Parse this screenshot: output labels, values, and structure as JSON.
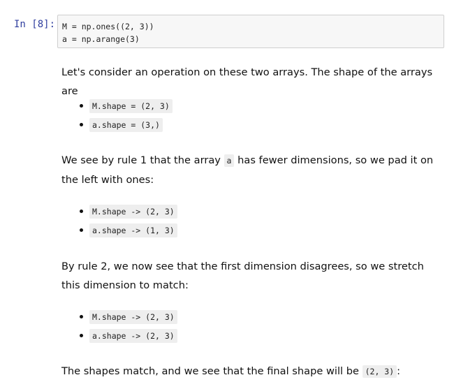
{
  "cell": {
    "prompt": "In [8]:",
    "code_lines": [
      "M = np.ones((2, 3))",
      "a = np.arange(3)"
    ]
  },
  "markdown": {
    "p1": "Let's consider an operation on these two arrays. The shape of the arrays are",
    "list1": [
      "M.shape = (2, 3)",
      "a.shape = (3,)"
    ],
    "p2_before": "We see by rule 1 that the array ",
    "p2_code": "a",
    "p2_after": " has fewer dimensions, so we pad it on the left with ones:",
    "list2": [
      "M.shape -> (2, 3)",
      "a.shape -> (1, 3)"
    ],
    "p3": "By rule 2, we now see that the first dimension disagrees, so we stretch this dimension to match:",
    "list3": [
      "M.shape -> (2, 3)",
      "a.shape -> (2, 3)"
    ],
    "p4_before": "The shapes match, and we see that the final shape will be ",
    "p4_code": "(2, 3)",
    "p4_after": ":"
  }
}
